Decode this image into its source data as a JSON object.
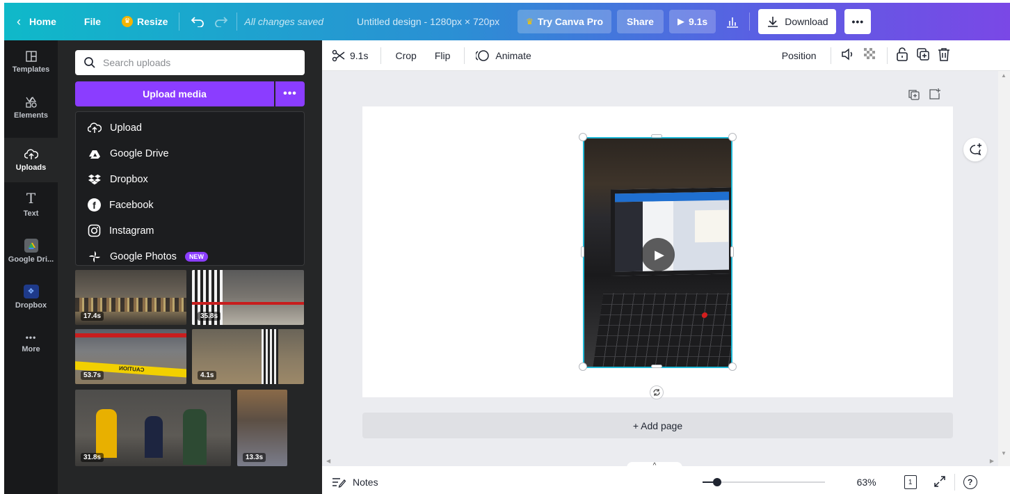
{
  "topbar": {
    "home": "Home",
    "file": "File",
    "resize": "Resize",
    "status": "All changes saved",
    "doc_title": "Untitled design - 1280px × 720px",
    "try_pro": "Try Canva Pro",
    "share": "Share",
    "play_time": "9.1s",
    "download": "Download"
  },
  "rail": {
    "items": [
      {
        "label": "Templates",
        "icon": "templates-icon"
      },
      {
        "label": "Elements",
        "icon": "elements-icon"
      },
      {
        "label": "Uploads",
        "icon": "cloud-upload-icon"
      },
      {
        "label": "Text",
        "icon": "text-icon"
      },
      {
        "label": "Google Dri...",
        "icon": "google-drive-icon"
      },
      {
        "label": "Dropbox",
        "icon": "dropbox-icon"
      },
      {
        "label": "More",
        "icon": "more-icon"
      }
    ],
    "active": "Uploads"
  },
  "panel": {
    "search_placeholder": "Search uploads",
    "upload_button": "Upload media",
    "menu": [
      {
        "label": "Upload",
        "icon": "cloud-upload-icon"
      },
      {
        "label": "Google Drive",
        "icon": "google-drive-icon"
      },
      {
        "label": "Dropbox",
        "icon": "dropbox-icon"
      },
      {
        "label": "Facebook",
        "icon": "facebook-icon"
      },
      {
        "label": "Instagram",
        "icon": "instagram-icon"
      },
      {
        "label": "Google Photos",
        "icon": "google-photos-icon",
        "badge": "NEW"
      }
    ],
    "thumbnails": [
      {
        "duration": "17.4s"
      },
      {
        "duration": "35.8s"
      },
      {
        "duration": "53.7s",
        "caption": "CAUTION"
      },
      {
        "duration": "4.1s"
      },
      {
        "duration": "31.8s"
      },
      {
        "duration": "13.3s"
      }
    ]
  },
  "toolbar": {
    "trim": "9.1s",
    "crop": "Crop",
    "flip": "Flip",
    "animate": "Animate",
    "position": "Position"
  },
  "canvas": {
    "add_page": "+ Add page"
  },
  "bottombar": {
    "notes": "Notes",
    "zoom": "63%",
    "page_num": "1",
    "zoom_level": 0.09
  },
  "colors": {
    "accent": "#8b3dff",
    "selection": "#1fb8d6",
    "annotation_arrow": "#ee0000"
  }
}
